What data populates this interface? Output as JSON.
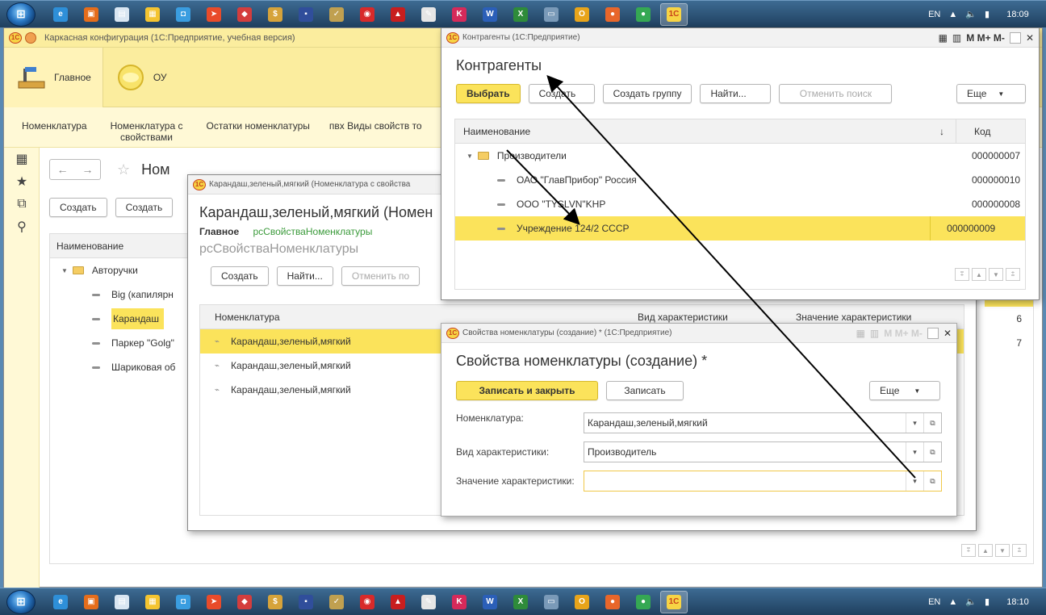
{
  "taskbar": {
    "lang": "EN",
    "time_top": "18:09",
    "time_bottom": "18:10",
    "icons": [
      {
        "name": "ie-icon",
        "glyph": "e",
        "color": "#2e8fd8"
      },
      {
        "name": "media-icon",
        "glyph": "▣",
        "color": "#e56d1b"
      },
      {
        "name": "notepad-icon",
        "glyph": "▤",
        "color": "#d9e6f2"
      },
      {
        "name": "paint-icon",
        "glyph": "▦",
        "color": "#f4c430"
      },
      {
        "name": "tool-icon",
        "glyph": "◘",
        "color": "#3a9de0"
      },
      {
        "name": "arrow-app-icon",
        "glyph": "➤",
        "color": "#e94b2a"
      },
      {
        "name": "diamond-icon",
        "glyph": "◆",
        "color": "#d43d3d"
      },
      {
        "name": "dollar-icon",
        "glyph": "$",
        "color": "#d6a33a"
      },
      {
        "name": "save-icon",
        "glyph": "▪",
        "color": "#304e9b"
      },
      {
        "name": "check-icon",
        "glyph": "✓",
        "color": "#c0a050"
      },
      {
        "name": "camera-icon",
        "glyph": "◉",
        "color": "#d82a2a"
      },
      {
        "name": "pdf-icon",
        "glyph": "▲",
        "color": "#c81e1e"
      },
      {
        "name": "edit-icon",
        "glyph": "✎",
        "color": "#e6e6e6"
      },
      {
        "name": "k-app-icon",
        "glyph": "K",
        "color": "#d62a5a"
      },
      {
        "name": "word-icon",
        "glyph": "W",
        "color": "#2b5fb8"
      },
      {
        "name": "excel-icon",
        "glyph": "X",
        "color": "#2e8b3a"
      },
      {
        "name": "display-icon",
        "glyph": "▭",
        "color": "#7a9ab8"
      },
      {
        "name": "outlook-icon",
        "glyph": "O",
        "color": "#e8a41a"
      },
      {
        "name": "firefox-icon",
        "glyph": "●",
        "color": "#e8662a"
      },
      {
        "name": "chrome-icon",
        "glyph": "●",
        "color": "#35a853"
      },
      {
        "name": "1c-icon",
        "glyph": "1С",
        "color": "#f7d444"
      }
    ]
  },
  "main": {
    "title": "Каркасная конфигурация  (1С:Предприятие, учебная версия)",
    "sections": [
      {
        "label": "Главное"
      },
      {
        "label": "ОУ"
      }
    ],
    "nav": [
      "Номенклатура",
      "Номенклатура с свойствами",
      "Остатки номенклатуры",
      "пвх Виды свойств то"
    ],
    "page_title": "Ном",
    "buttons": {
      "create": "Создать",
      "create2": "Создать"
    },
    "list_header": "Наименование",
    "group": "Авторучки",
    "items": [
      "Big (капилярн",
      "Карандаш",
      "Паркер \"Golg\"",
      "Шариковая об"
    ],
    "right_codes": [
      "17",
      "6",
      "7"
    ]
  },
  "pencil_win": {
    "title": "Карандаш,зеленый,мягкий (Номенклатура с свойства",
    "heading": "Карандаш,зеленый,мягкий (Номен",
    "tab_main": "Главное",
    "tab_props": "рсСвойстваНоменклатуры",
    "subheading": "рсСвойстваНоменклатуры",
    "btn_create": "Создать",
    "btn_find": "Найти...",
    "btn_cancel": "Отменить по",
    "col_nom": "Номенклатура",
    "col_kind": "Вид характеристики",
    "col_value": "Значение характеристики",
    "rows": [
      "Карандаш,зеленый,мягкий",
      "Карандаш,зеленый,мягкий",
      "Карандаш,зеленый,мягкий"
    ]
  },
  "kontr_win": {
    "title": "Контрагенты  (1С:Предприятие)",
    "heading": "Контрагенты",
    "mem_buttons": "M  M+  M-",
    "btn_select": "Выбрать",
    "btn_create": "Создать",
    "btn_group": "Создать группу",
    "btn_find": "Найти...",
    "btn_cancel": "Отменить поиск",
    "btn_more": "Еще",
    "col_name": "Наименование",
    "col_code": "Код",
    "rows": [
      {
        "name": "Производители",
        "code": "000000007"
      },
      {
        "name": "ОАО \"ГлавПрибор\" Россия",
        "code": "000000010"
      },
      {
        "name": "ООО \"TYSLVN\"KHP",
        "code": "000000008"
      },
      {
        "name": "Учреждение 124/2 СССР",
        "code": "000000009"
      }
    ]
  },
  "props_win": {
    "title": "Свойства номенклатуры (создание) *  (1С:Предприятие)",
    "mem_buttons": "M  M+  M-",
    "heading": "Свойства номенклатуры (создание) *",
    "btn_save_close": "Записать и закрыть",
    "btn_save": "Записать",
    "btn_more": "Еще",
    "label_nom": "Номенклатура:",
    "value_nom": "Карандаш,зеленый,мягкий",
    "label_kind": "Вид характеристики:",
    "value_kind": "Производитель",
    "label_value": "Значение характеристики:",
    "value_value": ""
  }
}
